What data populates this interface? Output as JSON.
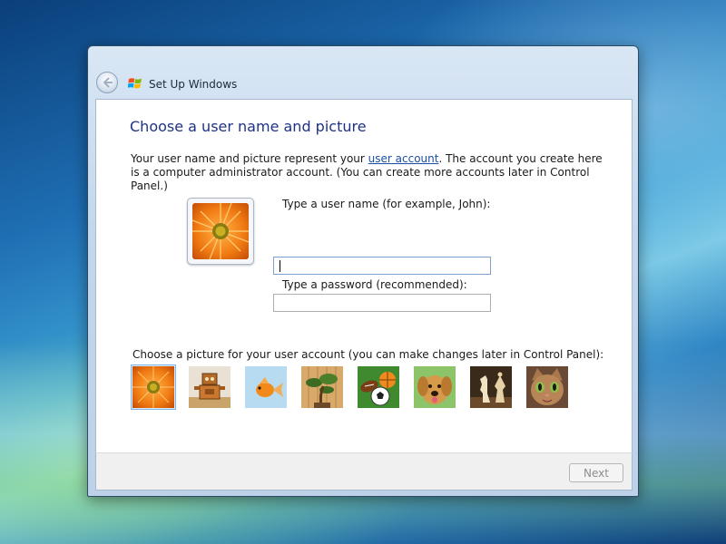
{
  "window": {
    "title": "Set Up Windows"
  },
  "page": {
    "heading": "Choose a user name and picture",
    "description_before": "Your user name and picture represent your ",
    "description_link": "user account",
    "description_after": ". The account you create here is a computer administrator account. (You can create more accounts later in Control Panel.)"
  },
  "form": {
    "username_label": "Type a user name (for example, John):",
    "username_value": "",
    "password_label": "Type a password (recommended):",
    "password_value": ""
  },
  "pictures": {
    "label": "Choose a picture for your user account (you can make changes later in Control Panel):",
    "items": [
      "flower",
      "robot",
      "goldfish",
      "bonsai",
      "sports-balls",
      "puppy",
      "chess-pieces",
      "kitten"
    ],
    "selected": "flower"
  },
  "footer": {
    "next_label": "Next",
    "next_enabled": false
  },
  "colors": {
    "heading": "#1e3287",
    "link": "#1a4fa5",
    "accent_selection": "#7eb4ea"
  }
}
